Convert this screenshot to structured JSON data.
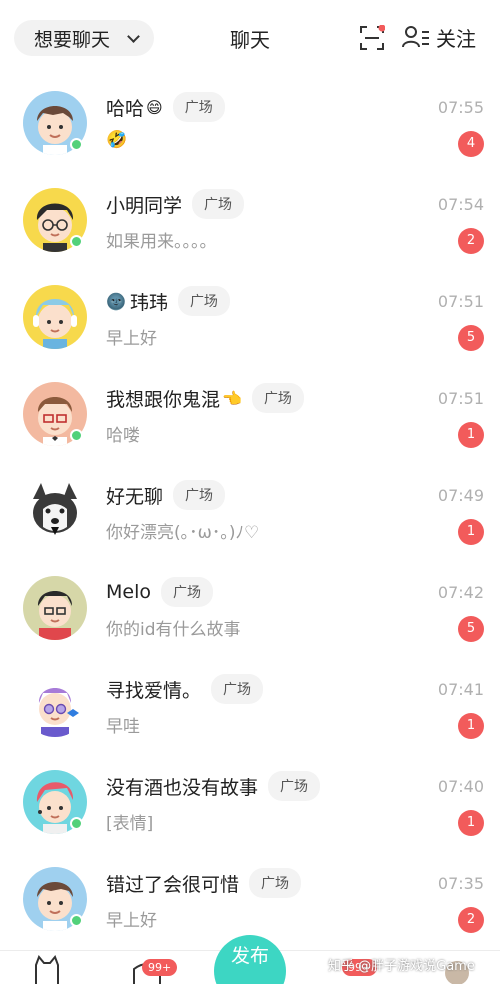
{
  "header": {
    "mode_label": "想要聊天",
    "title": "聊天",
    "follow_label": "关注"
  },
  "chats": [
    {
      "name": "哈哈",
      "name_emoji": "😄",
      "tag": "广场",
      "preview": "🤣",
      "time": "07:55",
      "unread": "4",
      "online": true
    },
    {
      "name": "小明同学",
      "tag": "广场",
      "preview": "如果用来。。。。",
      "time": "07:54",
      "unread": "2",
      "online": true
    },
    {
      "name": "玮玮",
      "name_prefix_emoji": "🌚",
      "tag": "广场",
      "preview": "早上好",
      "time": "07:51",
      "unread": "5",
      "online": false
    },
    {
      "name": "我想跟你鬼混",
      "name_emoji": "👈",
      "tag": "广场",
      "preview": "哈喽",
      "time": "07:51",
      "unread": "1",
      "online": true
    },
    {
      "name": "好无聊",
      "tag": "广场",
      "preview": "你好漂亮(｡･ω･｡)ﾉ♡",
      "time": "07:49",
      "unread": "1",
      "online": false
    },
    {
      "name": "Melo",
      "tag": "广场",
      "preview": "你的id有什么故事",
      "time": "07:42",
      "unread": "5",
      "online": false
    },
    {
      "name": "寻找爱情。",
      "tag": "广场",
      "preview": "早哇",
      "time": "07:41",
      "unread": "1",
      "online": false
    },
    {
      "name": "没有酒也没有故事",
      "tag": "广场",
      "preview": "[表情]",
      "time": "07:40",
      "unread": "1",
      "online": true
    },
    {
      "name": "错过了会很可惜",
      "tag": "广场",
      "preview": "早上好",
      "time": "07:35",
      "unread": "2",
      "online": true
    }
  ],
  "bottom_nav": {
    "badge_left": "99+",
    "publish_label": "发布",
    "badge_right": "99+",
    "watermark": "知乎 @胖子游戏说Game"
  },
  "colors": {
    "badge": "#f25b5b",
    "online": "#52d17a",
    "publish": "#3dd6c3"
  }
}
